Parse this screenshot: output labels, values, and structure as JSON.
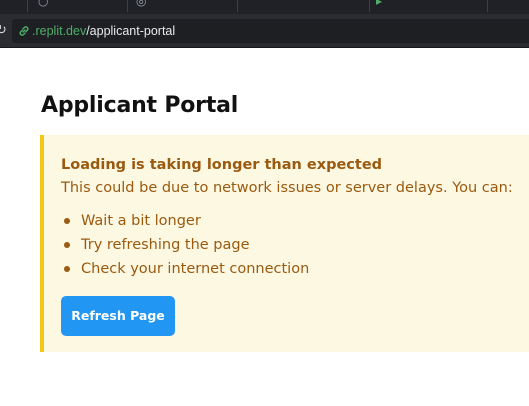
{
  "browser": {
    "url": {
      "domain": ".replit.dev",
      "path": "/applicant-portal"
    }
  },
  "page": {
    "title": "Applicant Portal"
  },
  "alert": {
    "heading": "Loading is taking longer than expected",
    "message": "This could be due to network issues or server delays. You can:",
    "suggestions": [
      "Wait a bit longer",
      "Try refreshing the page",
      "Check your internet connection"
    ],
    "button_label": "Refresh Page"
  },
  "colors": {
    "alert_background": "#fdf8e2",
    "alert_border": "#f5c518",
    "alert_text": "#9a5a10",
    "button_background": "#2196f3",
    "url_domain": "#4fb06a"
  }
}
